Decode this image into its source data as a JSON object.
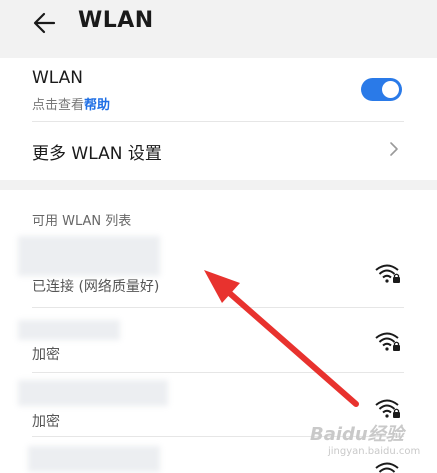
{
  "header": {
    "title": "WLAN"
  },
  "wlan": {
    "label": "WLAN",
    "hint_prefix": "点击查看",
    "hint_link": "帮助",
    "enabled": true
  },
  "more": {
    "label": "更多 WLAN 设置"
  },
  "list": {
    "title": "可用 WLAN 列表",
    "networks": [
      {
        "status": "已连接 (网络质量好)",
        "secured": true
      },
      {
        "status": "加密",
        "secured": true
      },
      {
        "status": "加密",
        "secured": true
      },
      {
        "status": "",
        "secured": true
      }
    ]
  },
  "watermark": {
    "brand": "Baidu经验",
    "sub": "jingyan.baidu.com"
  },
  "colors": {
    "accent": "#2a7ae8",
    "annotation": "#e8322e"
  }
}
